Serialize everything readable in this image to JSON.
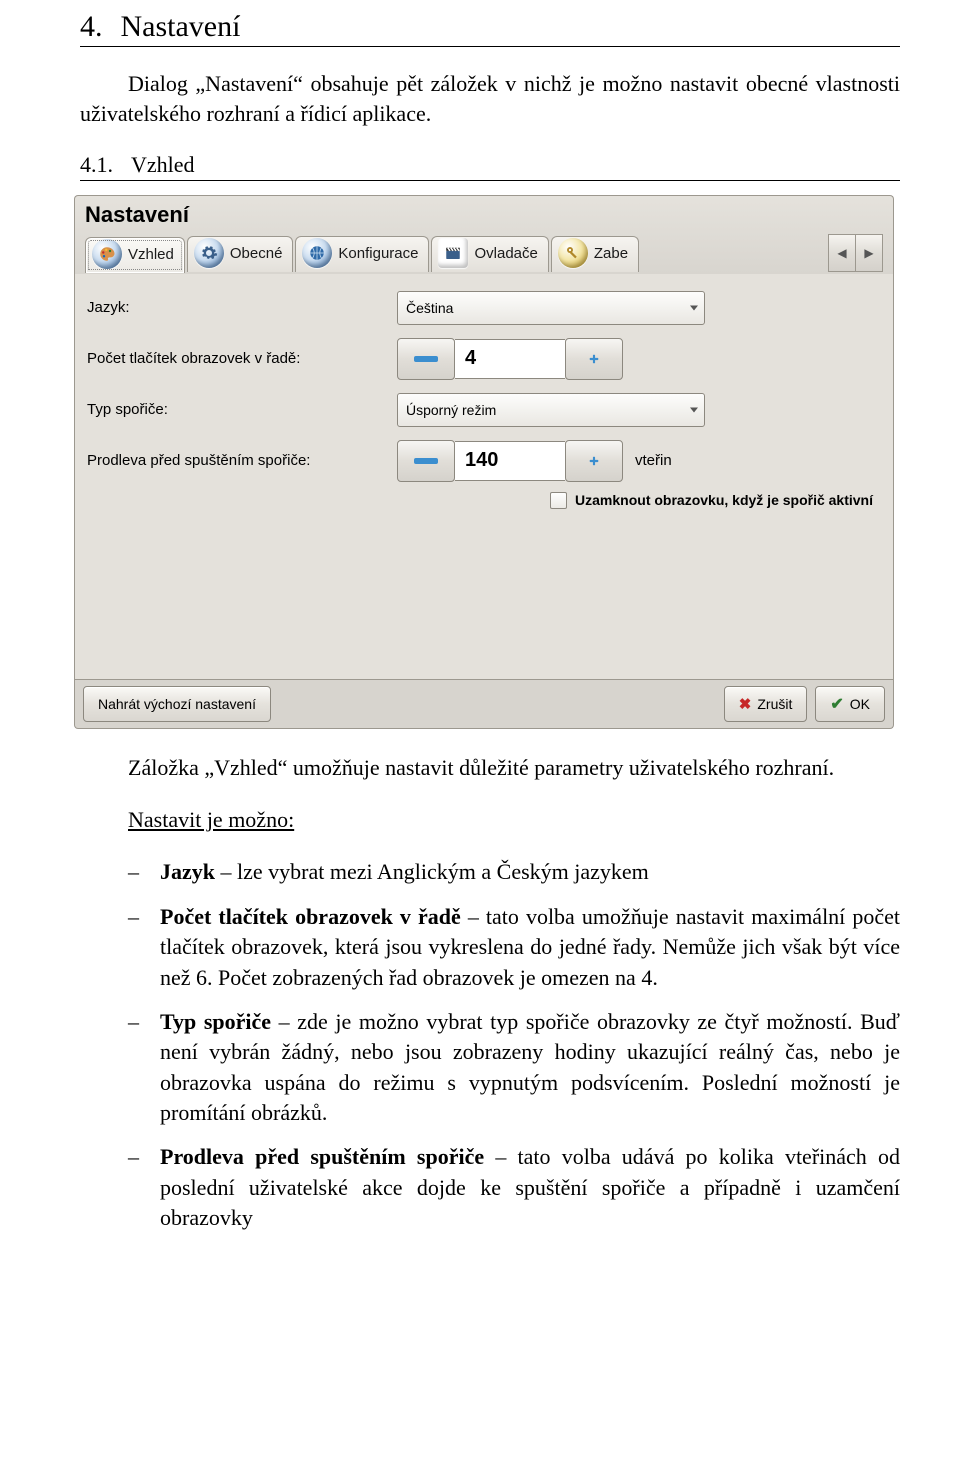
{
  "doc": {
    "section_num": "4.",
    "section_title": "Nastavení",
    "intro": "Dialog „Nastavení“ obsahuje pět záložek v nichž je možno nastavit obecné vlastnosti uživatelského rozhraní a řídicí aplikace.",
    "subsection_num": "4.1.",
    "subsection_title": "Vzhled",
    "after_shot_intro": "Záložka „Vzhled“ umožňuje nastavit důležité parametry uživatelského rozhraní.",
    "can_set_label": "Nastavit je možno:",
    "items": [
      {
        "bold": "Jazyk",
        "rest": " – lze vybrat mezi Anglickým a Českým jazykem"
      },
      {
        "bold": "Počet tlačítek obrazovek v řadě",
        "rest": " – tato volba umožňuje nastavit maximální počet tlačítek obrazovek, která jsou vykreslena do jedné řady. Nemůže jich však být více než 6. Počet zobrazených řad obrazovek je omezen na 4."
      },
      {
        "bold": "Typ spořiče",
        "rest": " – zde je možno vybrat typ spořiče obrazovky ze čtyř možností. Buď není vybrán žádný, nebo jsou zobrazeny hodiny ukazující reálný čas, nebo je obrazovka uspána do režimu s vypnutým podsvícením. Poslední možností je promítání obrázků."
      },
      {
        "bold": "Prodleva před spuštěním spořiče",
        "rest": " – tato volba udává po kolika vteřinách od poslední uživatelské akce dojde ke spuštění spořiče a případně i uzamčení obrazovky"
      }
    ]
  },
  "shot": {
    "title": "Nastavení",
    "tabs": [
      "Vzhled",
      "Obecné",
      "Konfigurace",
      "Ovladače",
      "Zabe"
    ],
    "fields": {
      "language_label": "Jazyk:",
      "language_value": "Čeština",
      "buttons_label": "Počet tlačítek obrazovek v řadě:",
      "buttons_value": "4",
      "saver_label": "Typ spořiče:",
      "saver_value": "Úsporný režim",
      "delay_label": "Prodleva před spuštěním spořiče:",
      "delay_value": "140",
      "delay_unit": "vteřin",
      "lock_label": "Uzamknout obrazovku, když je spořič aktivní"
    },
    "buttons": {
      "load_defaults": "Nahrát výchozí nastavení",
      "cancel": "Zrušit",
      "ok": "OK"
    }
  }
}
